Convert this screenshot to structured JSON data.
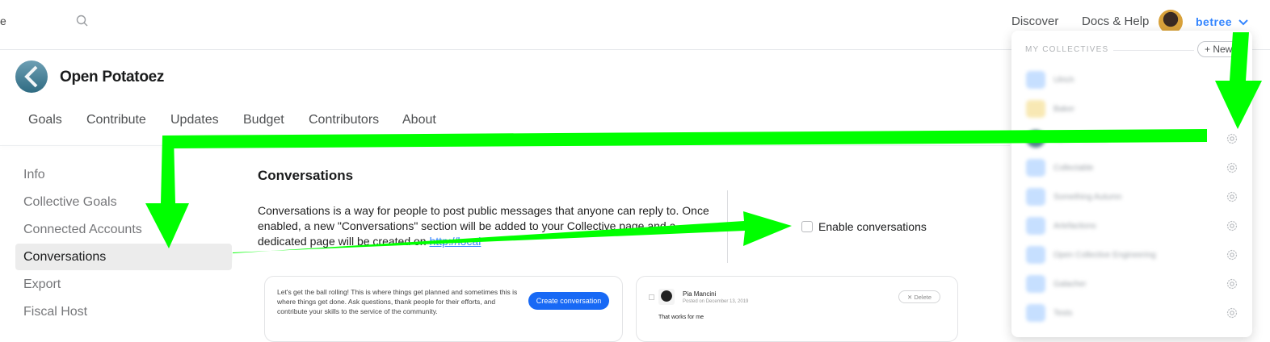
{
  "topbar": {
    "search_fragment": "e",
    "links": [
      "Discover",
      "Docs & Help"
    ],
    "user_name": "betree"
  },
  "collective": {
    "name": "Open Potatoez",
    "tabs": [
      "Goals",
      "Contribute",
      "Updates",
      "Budget",
      "Contributors",
      "About"
    ]
  },
  "menu": {
    "items": [
      "Info",
      "Collective Goals",
      "Connected Accounts",
      "Conversations",
      "Export",
      "Fiscal Host"
    ],
    "active": "Conversations"
  },
  "main": {
    "title": "Conversations",
    "description_1": "Conversations is a way for people to post public messages that anyone can reply to. Once enabled, a new \"Conversations\" section will be added to your Collective page and a dedicated page will be created on ",
    "description_link": "http://local",
    "description_2": "",
    "checkbox_label": "Enable conversations",
    "checkbox_checked": false
  },
  "preview": {
    "card1_text": "Let's get the ball rolling! This is where things get planned and sometimes this is where things get done. Ask questions, thank people for their efforts, and contribute your skills to the service of the community.",
    "create_button": "Create conversation",
    "poster_name": "Pia Mancini",
    "posted_on": "Posted on December 13, 2019",
    "delete_label": "Delete",
    "reply_text": "That works for me"
  },
  "dropdown": {
    "section_title": "MY COLLECTIVES",
    "new_button": "+ New",
    "collectives": [
      "Ulrich",
      "Baker",
      "Open Potatoez",
      "Collectable",
      "Something Autumn",
      "Artefactions",
      "Open Collective Engineering",
      "Galacher",
      "Tests"
    ]
  },
  "colors": {
    "accent": "#3385ff",
    "button_blue": "#1869f5",
    "annotation_arrow": "#00ff00",
    "active_menu_bg": "#ececec"
  }
}
